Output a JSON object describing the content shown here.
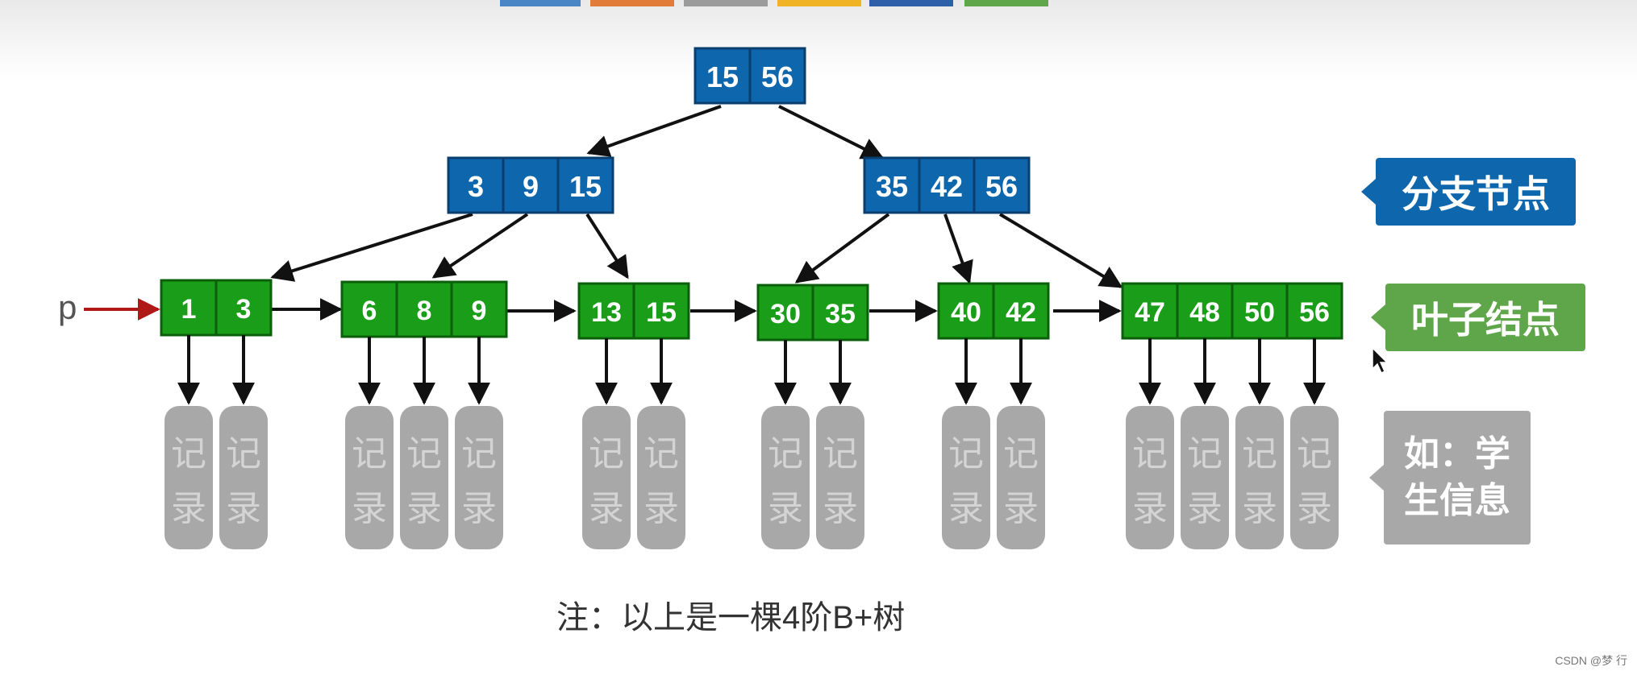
{
  "tree": {
    "root": {
      "keys": [
        "15",
        "56"
      ]
    },
    "branches": [
      {
        "keys": [
          "3",
          "9",
          "15"
        ]
      },
      {
        "keys": [
          "35",
          "42",
          "56"
        ]
      }
    ],
    "leaves": [
      {
        "keys": [
          "1",
          "3"
        ]
      },
      {
        "keys": [
          "6",
          "8",
          "9"
        ]
      },
      {
        "keys": [
          "13",
          "15"
        ]
      },
      {
        "keys": [
          "30",
          "35"
        ]
      },
      {
        "keys": [
          "40",
          "42"
        ]
      },
      {
        "keys": [
          "47",
          "48",
          "50",
          "56"
        ]
      }
    ],
    "record_label": [
      "记",
      "录"
    ],
    "pointer_label": "p"
  },
  "legend": {
    "branch": "分支节点",
    "leaf": "叶子结点",
    "example_line1": "如：学",
    "example_line2": "生信息"
  },
  "caption": "注：以上是一棵4阶B+树",
  "watermark": "CSDN @梦 行",
  "colors": {
    "branch_node": "#0e67ad",
    "leaf_node": "#1a9e1a",
    "record": "#a8a8a8",
    "pointer_arrow": "#b01818",
    "edge": "#111111"
  }
}
